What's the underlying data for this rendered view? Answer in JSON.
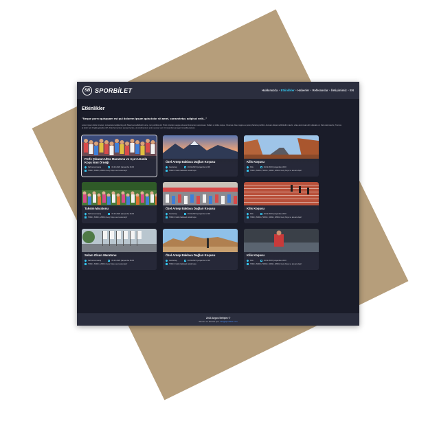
{
  "brand": {
    "badge": "SB",
    "name": "SPORBİLET"
  },
  "nav": {
    "items": [
      {
        "label": "Hakkımızda",
        "active": false
      },
      {
        "label": "Etkinlikler",
        "active": true
      },
      {
        "label": "Haberler",
        "active": false
      },
      {
        "label": "Referanslar",
        "active": false
      },
      {
        "label": "İletişimimiz",
        "active": false
      },
      {
        "label": "EN",
        "active": false
      }
    ],
    "separator": "•"
  },
  "page": {
    "title": "Etkinlikler",
    "quote": "\"Neque porro quisquam est qui dolorem ipsum quia dolor sit amet, consectetur, adipisci velit...\"",
    "body": "Lorem ipsum dolor sit amet, consectetur adipiscing elit. Mauris et sollicitudin urna, non porttitor elit. Proin interdum augue sit amet fermentum accumsan. Nullam ut tellus neque. Vivamus vitae magna eu justo pharetra porttitor. Aenean aliquet sollicitudin mauris, vitae accumsan elit vulputate ut. Sed erat mauris, rhoncus at dolor vel, fringilla gravida nibh. Duis fermentum semper lectus, ut condimentum enim semper vel. Ut imperdiet est eget convallis pretium."
  },
  "events": [
    {
      "title": "Perfe Çıkaran Ultra Maratonu ve Aşırı Uzunlu Koşu İsmi Örneği",
      "location": "Kahramanmaraş",
      "date": "19.02.2023 Çarşamba 16:00",
      "distances": "7000m, 6000m, 2000m Genç Koşu ve ara ara deprr",
      "image": "marathon-crowd",
      "featured": true
    },
    {
      "title": "Özel Antep Baklava Dağları Koşusu",
      "location": "Gaziantep",
      "date": "19.02.2023 Çarşamba 14:00",
      "distances": "7000m Fıstıklı baklavalı ondalı koşu",
      "image": "mountain-sunset",
      "featured": false
    },
    {
      "title": "Kilis Koşusu",
      "location": "Kilis",
      "date": "19.02.2023 Çarşamba 16:00",
      "distances": "7000m, 6000m, 5000m, 3400m, 2800m Genç Koşu ve ara ara deprr",
      "image": "canyon-road",
      "featured": false
    },
    {
      "title": "Taksim Maratonu",
      "location": "Kahramanmaraş",
      "date": "19.02.2023 Çarşamba 16:00",
      "distances": "7000m, 6000m, 2000m Genç Koşu ve ara ara deprr",
      "image": "city-runners",
      "featured": false
    },
    {
      "title": "Özel Antep Baklava Dağları Koşusu",
      "location": "Gaziantep",
      "date": "19.02.2023 Çarşamba 14:00",
      "distances": "7000m Fıstıklı baklavalı ondalı koşu",
      "image": "race-start",
      "featured": false
    },
    {
      "title": "Kilis Koşusu",
      "location": "Kilis",
      "date": "19.02.2023 Çarşamba 16:00",
      "distances": "7000m, 6000m, 5000m, 3400m, 2800m Genç Koşu ve ara ara deprr",
      "image": "track-sprinters",
      "featured": false
    },
    {
      "title": "Selam Olsun Maratonu",
      "location": "Kahramanmaraş",
      "date": "19.02.2023 Çarşamba 16:00",
      "distances": "7000m, 6000m, 2000m Genç Koşu ve ara ara deprr",
      "image": "flag-street",
      "featured": false
    },
    {
      "title": "Özel Antep Baklava Dağları Koşusu",
      "location": "Gaziantep",
      "date": "19.02.2023 Çarşamba 14:00",
      "distances": "7000m Fıstıklı baklavalı ondalı koşu",
      "image": "desert-runner",
      "featured": false
    },
    {
      "title": "Kilis Koşusu",
      "location": "Kilis",
      "date": "19.02.2023 Çarşamba 16:00",
      "distances": "7000m, 6000m, 5000m, 3400m, 2800m Genç Koşu ve ara ara deprr",
      "image": "runner-portrait",
      "featured": false
    }
  ],
  "footer": {
    "copyright": "2023 Argos İletişim ©",
    "contact_label": "Tanıtım ve Destek için:",
    "contact_email": "info@sporbilet.com"
  },
  "colors": {
    "accent": "#35c5ec",
    "panel": "#1a1c29",
    "bar": "#2b2e3e",
    "backdrop": "#b69e7b",
    "link": "#4b8cf5"
  }
}
